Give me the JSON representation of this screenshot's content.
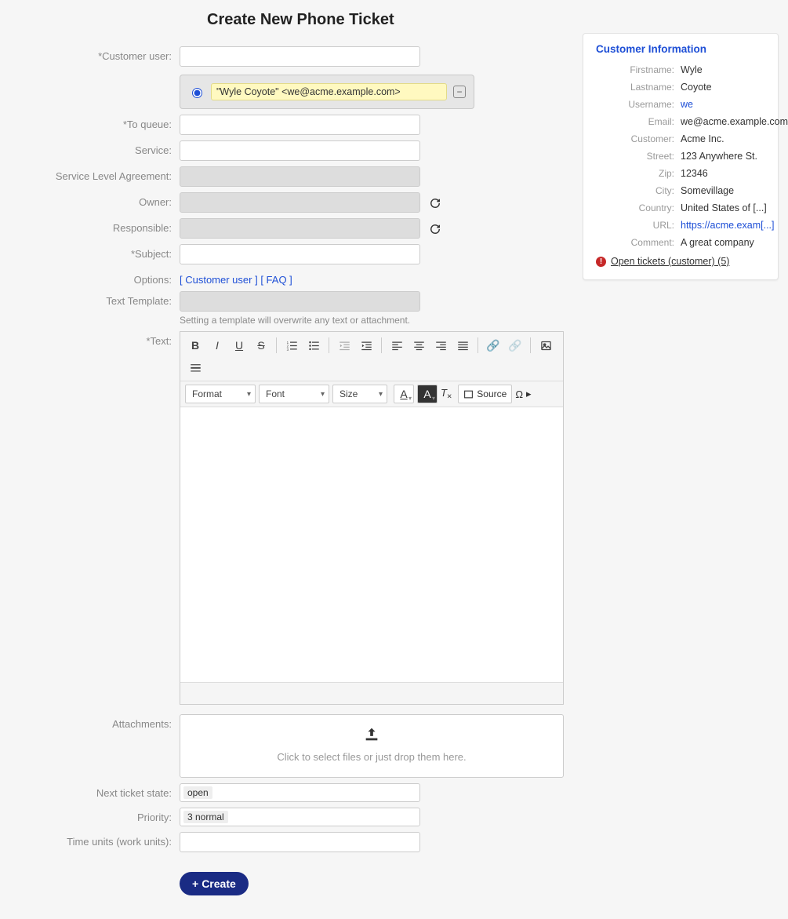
{
  "title": "Create New Phone Ticket",
  "labels": {
    "customer_user": "Customer user:",
    "to_queue": "To queue:",
    "service": "Service:",
    "sla": "Service Level Agreement:",
    "owner": "Owner:",
    "responsible": "Responsible:",
    "subject": "Subject:",
    "options": "Options:",
    "text_template": "Text Template:",
    "text": "Text:",
    "attachments": "Attachments:",
    "next_state": "Next ticket state:",
    "priority": "Priority:",
    "time_units": "Time units (work units):"
  },
  "form": {
    "customer_user_value": "",
    "customer_selected": "\"Wyle Coyote\" <we@acme.example.com>",
    "to_queue": "",
    "service": "",
    "sla": "",
    "owner": "",
    "responsible": "",
    "subject": "",
    "text_template": "",
    "text_template_hint": "Setting a template will overwrite any text or attachment.",
    "next_state": "open",
    "priority": "3 normal",
    "time_units": ""
  },
  "options_links": {
    "customer_user": "[ Customer user ]",
    "faq": "[ FAQ ]"
  },
  "editor": {
    "format": "Format",
    "font": "Font",
    "size": "Size",
    "source": "Source"
  },
  "attach": {
    "hint": "Click to select files or just drop them here."
  },
  "create_button": "Create",
  "sidebar": {
    "title": "Customer Information",
    "fields": {
      "firstname_l": "Firstname:",
      "firstname_v": "Wyle",
      "lastname_l": "Lastname:",
      "lastname_v": "Coyote",
      "username_l": "Username:",
      "username_v": "we",
      "email_l": "Email:",
      "email_v": "we@acme.example.com",
      "customer_l": "Customer:",
      "customer_v": "Acme Inc.",
      "street_l": "Street:",
      "street_v": "123 Anywhere St.",
      "zip_l": "Zip:",
      "zip_v": "12346",
      "city_l": "City:",
      "city_v": "Somevillage",
      "country_l": "Country:",
      "country_v": "United States of [...]",
      "url_l": "URL:",
      "url_v": "https://acme.exam[...]",
      "comment_l": "Comment:",
      "comment_v": "A great company"
    },
    "open_tickets": "Open tickets (customer) (5)"
  }
}
